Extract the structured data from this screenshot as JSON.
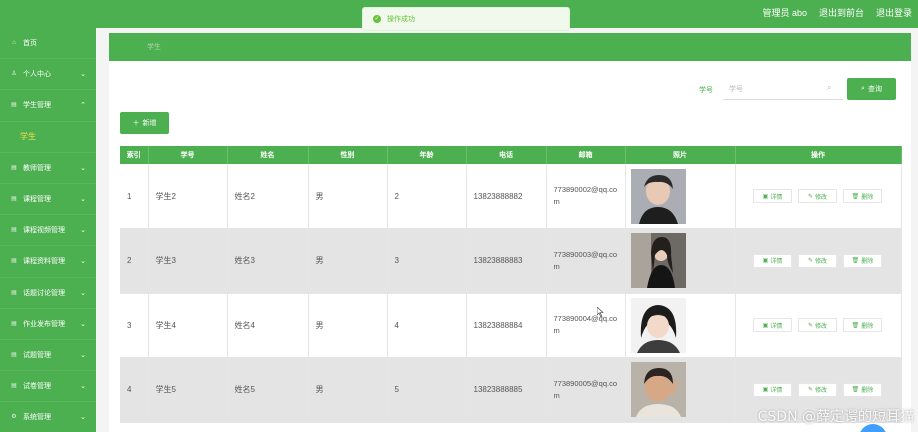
{
  "header": {
    "user_label": "管理员 abo",
    "back_label": "退出到前台",
    "logout_label": "退出登录"
  },
  "toast": {
    "message": "操作成功"
  },
  "sidebar": {
    "items": [
      {
        "label": "首页",
        "icon": "home-icon",
        "arrow": ""
      },
      {
        "label": "个人中心",
        "icon": "user-icon",
        "arrow": "⌄"
      },
      {
        "label": "学生管理",
        "icon": "doc-icon",
        "arrow": "⌃"
      },
      {
        "label": "学生",
        "icon": "",
        "arrow": ""
      },
      {
        "label": "教师管理",
        "icon": "doc-icon",
        "arrow": "⌄"
      },
      {
        "label": "课程管理",
        "icon": "doc-icon",
        "arrow": "⌄"
      },
      {
        "label": "课程视频管理",
        "icon": "doc-icon",
        "arrow": "⌄"
      },
      {
        "label": "课程资料管理",
        "icon": "doc-icon",
        "arrow": "⌄"
      },
      {
        "label": "话题讨论管理",
        "icon": "doc-icon",
        "arrow": "⌄"
      },
      {
        "label": "作业发布管理",
        "icon": "doc-icon",
        "arrow": "⌄"
      },
      {
        "label": "试题管理",
        "icon": "doc-icon",
        "arrow": "⌄"
      },
      {
        "label": "试卷管理",
        "icon": "doc-icon",
        "arrow": "⌄"
      },
      {
        "label": "系统管理",
        "icon": "gear-icon",
        "arrow": "⌄"
      }
    ]
  },
  "breadcrumb": {
    "current": "学生"
  },
  "search": {
    "label": "学号",
    "placeholder": "学号",
    "button_label": "查询"
  },
  "toolbar": {
    "add_label": "新增"
  },
  "table": {
    "headers": [
      "索引",
      "学号",
      "姓名",
      "性别",
      "年龄",
      "电话",
      "邮箱",
      "照片",
      "操作"
    ],
    "rows": [
      {
        "index": "1",
        "id": "学生2",
        "name": "姓名2",
        "gender": "男",
        "age": "2",
        "phone": "13823888882",
        "email": "773890002@qq.com"
      },
      {
        "index": "2",
        "id": "学生3",
        "name": "姓名3",
        "gender": "男",
        "age": "3",
        "phone": "13823888883",
        "email": "773890003@qq.com"
      },
      {
        "index": "3",
        "id": "学生4",
        "name": "姓名4",
        "gender": "男",
        "age": "4",
        "phone": "13823888884",
        "email": "773890004@qq.com"
      },
      {
        "index": "4",
        "id": "学生5",
        "name": "姓名5",
        "gender": "男",
        "age": "5",
        "phone": "13823888885",
        "email": "773890005@qq.com"
      }
    ],
    "actions": {
      "detail": "详情",
      "edit": "修改",
      "delete": "删除"
    }
  },
  "watermark": "CSDN @薛定谔的短耳猫",
  "colors": {
    "primary": "#4caf50",
    "highlight": "#f4e04d"
  }
}
